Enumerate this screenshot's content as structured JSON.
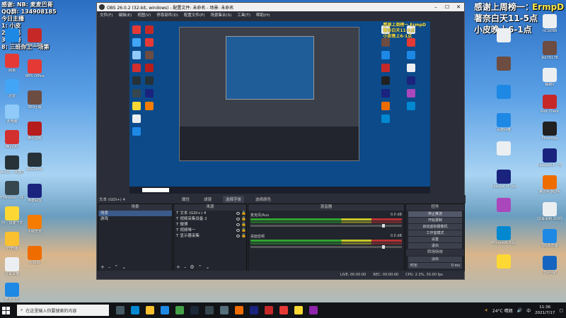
{
  "overlay": {
    "top_left_lines": [
      "感谢: NB: 麦麦巴哥",
      "QQ群: 134908185",
      "今日主播",
      "1: 小皮",
      "2: 网易",
      "3: 韩涛",
      "8: 三班你上一场第"
    ],
    "top_right_lines": [
      "感谢上周榜一：",
      "ErmpD",
      "著奈白天11-5点",
      "小皮晚上6-1点"
    ],
    "preview_overlay_lines": [
      "感谢上周榜一 ErmpD",
      "著奈白天11-5点",
      "小皮晚上6-1点"
    ]
  },
  "desktop_icons_left": [
    {
      "label": "",
      "color": "#1e88e5"
    },
    {
      "label": "网易",
      "color": "#e53935"
    },
    {
      "label": "迅雷",
      "color": "#42a5f5"
    },
    {
      "label": "此电脑",
      "color": "#90caf9"
    },
    {
      "label": "腾讯QQ",
      "color": "#d32f2f"
    },
    {
      "label": "obs32 - 快捷方式",
      "color": "#263238"
    },
    {
      "label": "YYAnchor - 快捷方式",
      "color": "#37474f"
    },
    {
      "label": "YY - 快捷方式",
      "color": "#fdd835"
    },
    {
      "label": "YY开播",
      "color": "#fbc02d"
    },
    {
      "label": "屏幕录像",
      "color": "#eceff1"
    },
    {
      "label": "酷狗音乐",
      "color": "#1e88e5"
    }
  ],
  "desktop_icons_col2": [
    {
      "label": "网易云音乐",
      "color": "#c62828"
    },
    {
      "label": "WPS Office",
      "color": "#e53935"
    },
    {
      "label": "360压缩",
      "color": "#6d4c41"
    },
    {
      "label": "腾讯视频",
      "color": "#b71c1c"
    },
    {
      "label": "WeGame",
      "color": "#263238"
    },
    {
      "label": "英雄联盟",
      "color": "#1a237e"
    },
    {
      "label": "火绒安全",
      "color": "#f57c00"
    },
    {
      "label": "火绒剑",
      "color": "#ef6c00"
    }
  ],
  "desktop_icons_right": [
    {
      "label": "nCSDB8",
      "color": "#eceff1"
    },
    {
      "label": "Jkk76178",
      "color": "#6d4c41"
    },
    {
      "label": "蝴蝶V",
      "color": "#eceff1"
    },
    {
      "label": "Riot Client",
      "color": "#c62828"
    },
    {
      "label": "Phasmop",
      "color": "#212121"
    },
    {
      "label": "LeagueCli - 快捷方式",
      "color": "#1a237e"
    },
    {
      "label": "腾讯手游助手",
      "color": "#ef6c00"
    },
    {
      "label": "屏幕录制 2020/1/1",
      "color": "#eceff1"
    },
    {
      "label": "QQ浏览器",
      "color": "#1e88e5"
    },
    {
      "label": "上网导航",
      "color": "#1565c0"
    }
  ],
  "desktop_icons_right2": [
    {
      "label": "",
      "color": "#eceff1"
    },
    {
      "label": "",
      "color": "#6d4c41"
    },
    {
      "label": "",
      "color": "#1e88e5"
    },
    {
      "label": "百度网盘",
      "color": "#1e88e5"
    },
    {
      "label": "",
      "color": "#eceff1"
    },
    {
      "label": "League of Legends",
      "color": "#1a237e"
    },
    {
      "label": "",
      "color": "#ab47bc"
    },
    {
      "label": "Microsoft Edge",
      "color": "#0288d1"
    },
    {
      "label": "",
      "color": "#fdd835"
    }
  ],
  "obs": {
    "title": "OBS 26.0.2 (32-bit, windows) - 配置文件: 未命名 - 场景: 未命名",
    "menu": [
      "文件(F)",
      "编辑(E)",
      "视图(V)",
      "停靠部件(D)",
      "配置文件(P)",
      "场景集合(S)",
      "工具(T)",
      "帮助(H)"
    ],
    "status_source": "文本 (GDI+) 4",
    "tabs": [
      "属性",
      "滤镜",
      "选择字体",
      "选择颜色"
    ],
    "scenes_header": "场景",
    "scenes": [
      "场景",
      "游戏"
    ],
    "sources_header": "来源",
    "sources": [
      "文本 (GDI+) 4",
      "视频采集设备 2",
      "微博",
      "视频唯一",
      "显示器采集"
    ],
    "mixer_header": "混音器",
    "tracks": [
      {
        "name": "麦克风/Aux",
        "db": "0.0 dB"
      },
      {
        "name": "桌面音频",
        "db": "0.0 dB"
      }
    ],
    "controls_header": "控件",
    "controls": [
      "停止推流",
      "开始录制",
      "启动虚拟摄像机",
      "工作室模式",
      "设置",
      "退出"
    ],
    "transitions_header": "转场特效",
    "transition_value": "淡出",
    "duration_label": "时长",
    "duration_value": "0 ms",
    "status_items": [
      "LIVE: 00:00:00",
      "REC: 00:00:00",
      "CPU: 2.3%, 30.00 fps"
    ]
  },
  "taskbar": {
    "search_placeholder": "在这里输入你要搜索的内容",
    "weather": "24°C 晴朗",
    "time": "11:36",
    "date": "2021/7/17",
    "input_lang": "中"
  }
}
